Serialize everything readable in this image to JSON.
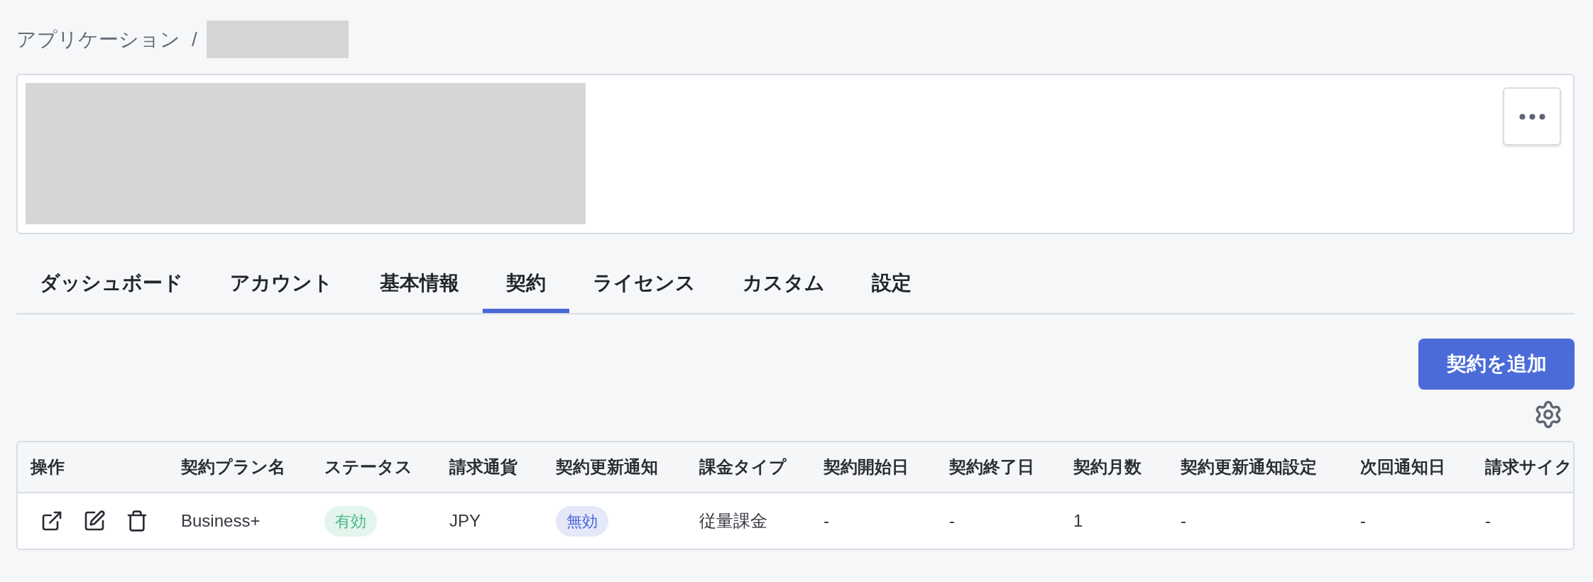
{
  "breadcrumb": {
    "root": "アプリケーション",
    "separator": "/"
  },
  "tabs": [
    {
      "label": "ダッシュボード",
      "selected": false
    },
    {
      "label": "アカウント",
      "selected": false
    },
    {
      "label": "基本情報",
      "selected": false
    },
    {
      "label": "契約",
      "selected": true
    },
    {
      "label": "ライセンス",
      "selected": false
    },
    {
      "label": "カスタム",
      "selected": false
    },
    {
      "label": "設定",
      "selected": false
    }
  ],
  "add_button": "契約を追加",
  "table": {
    "columns": [
      "操作",
      "契約プラン名",
      "ステータス",
      "請求通貨",
      "契約更新通知",
      "課金タイプ",
      "契約開始日",
      "契約終了日",
      "契約月数",
      "契約更新通知設定",
      "次回通知日",
      "請求サイク"
    ],
    "rows": [
      {
        "cells": [
          {
            "kind": "actions"
          },
          {
            "kind": "text",
            "text": "Business+"
          },
          {
            "kind": "badge",
            "text": "有効",
            "color": "#46b987"
          },
          {
            "kind": "text",
            "text": "JPY"
          },
          {
            "kind": "badge",
            "text": "無効",
            "color": "#4a64d6"
          },
          {
            "kind": "text",
            "text": "従量課金"
          },
          {
            "kind": "text",
            "text": "-"
          },
          {
            "kind": "text",
            "text": "-"
          },
          {
            "kind": "text",
            "text": "1"
          },
          {
            "kind": "text",
            "text": "-"
          },
          {
            "kind": "text",
            "text": "-"
          },
          {
            "kind": "text",
            "text": "-"
          }
        ]
      }
    ]
  }
}
